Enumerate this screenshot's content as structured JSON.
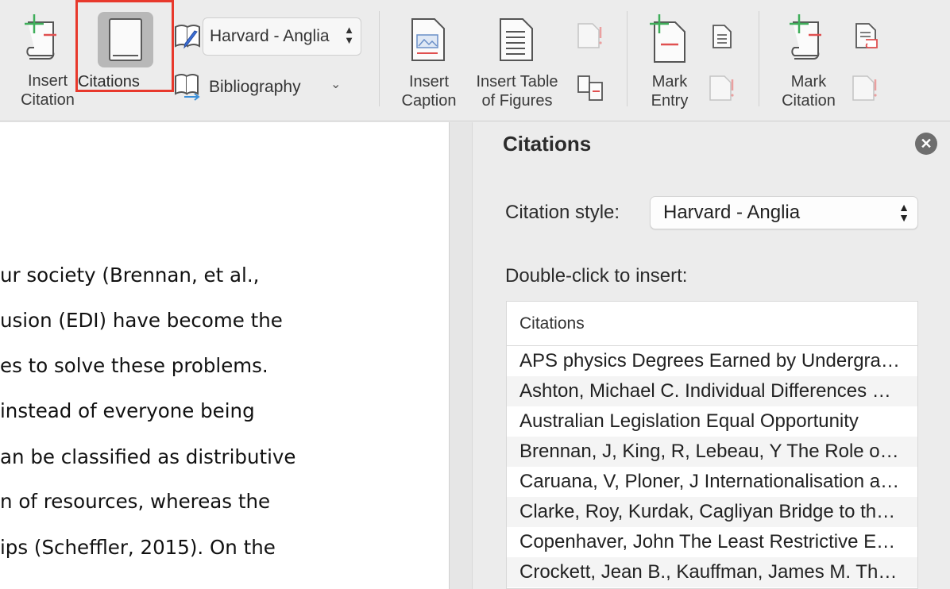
{
  "ribbon": {
    "insert_citation": "Insert\nCitation",
    "citations": "Citations",
    "style_value": "Harvard - Anglia",
    "bibliography": "Bibliography",
    "insert_caption": "Insert\nCaption",
    "insert_table_of_figures": "Insert Table\nof Figures",
    "mark_entry": "Mark\nEntry",
    "mark_citation": "Mark\nCitation"
  },
  "document": {
    "lines": [
      "ur society (Brennan, et al.,",
      "usion (EDI) have become the",
      "es to solve these problems.",
      " instead of everyone being",
      "an be classified as distributive",
      "n of resources, whereas the",
      "ips (Scheffler, 2015). On the"
    ]
  },
  "pane": {
    "title": "Citations",
    "style_label": "Citation style:",
    "style_value": "Harvard - Anglia",
    "double_click_label": "Double-click to insert:",
    "list_header": "Citations",
    "items": [
      "APS physics Degrees Earned by Undergraduate",
      "Ashton, Michael C. Individual Differences and Personality",
      "Australian Legislation Equal Opportunity",
      "Brennan, J, King, R,  Lebeau, Y The Role of Universities",
      "Caruana, V,  Ploner, J Internationalisation and Equality",
      "Clarke, Roy,  Kurdak, Cagliyan Bridge to the Doctorate",
      "Copenhaver, John The Least Restrictive Environment",
      "Crockett, Jean B.,  Kauffman, James M. The Least Restrictive"
    ]
  },
  "colors": {
    "highlight_border": "#e8392c",
    "icon_green": "#3fae5a",
    "icon_red": "#e05050"
  }
}
